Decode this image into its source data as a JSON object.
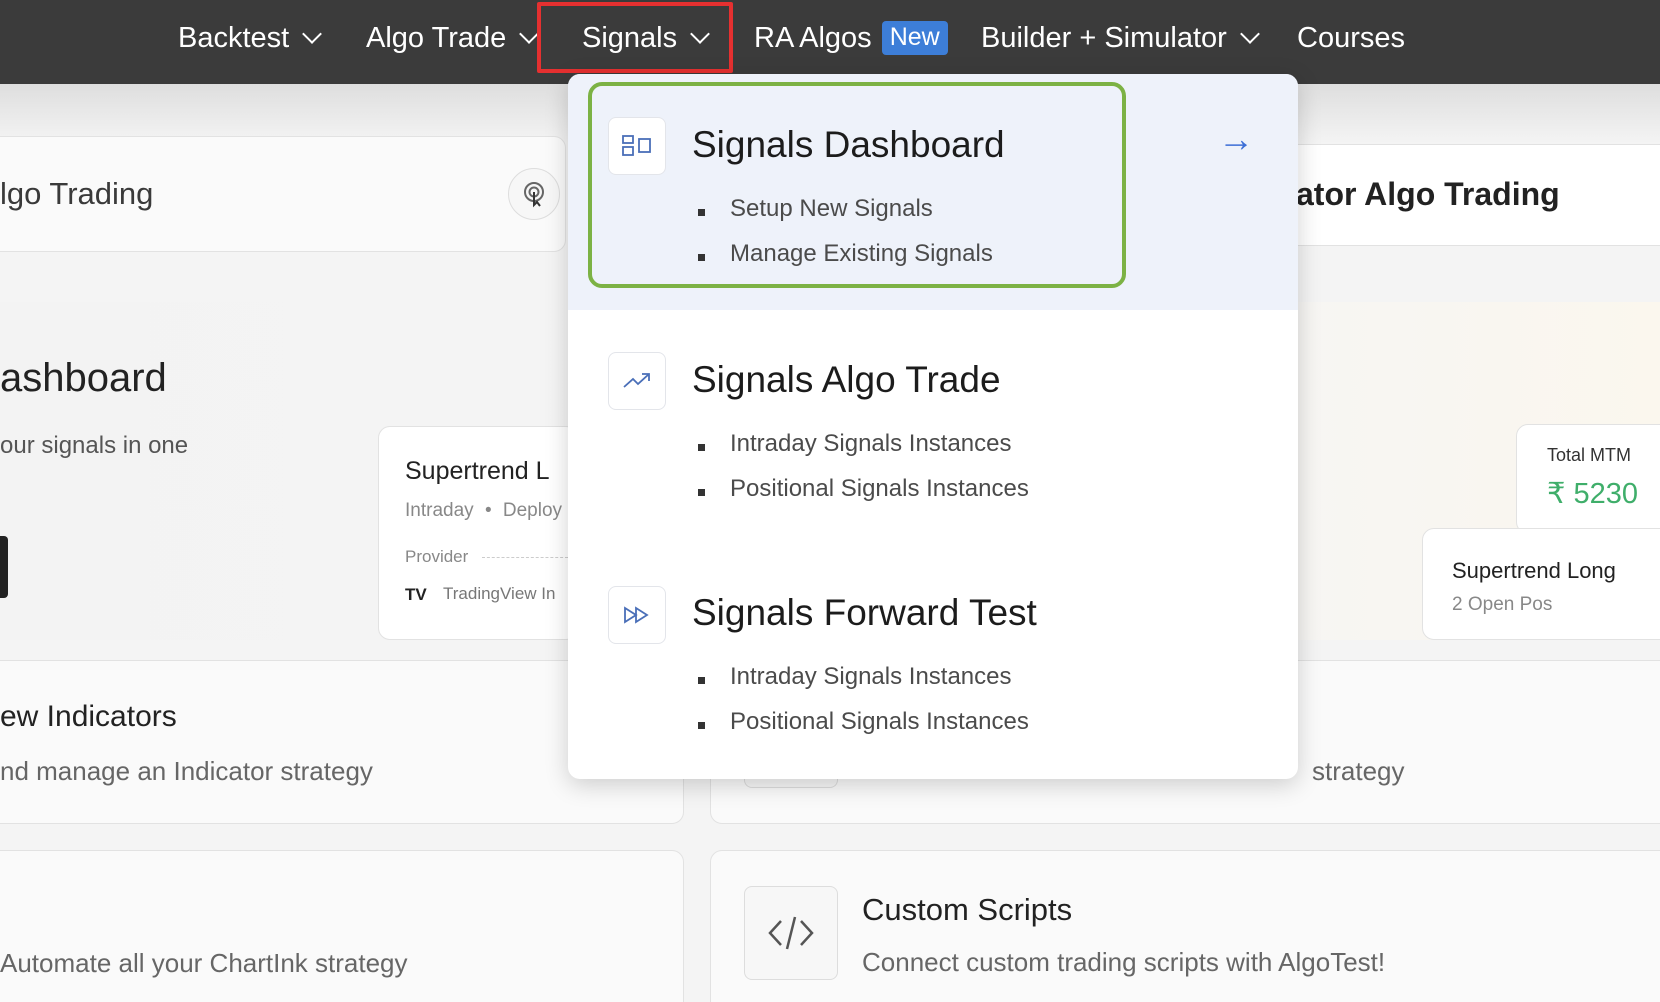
{
  "nav": {
    "items": [
      {
        "label": "Backtest"
      },
      {
        "label": "Algo Trade"
      },
      {
        "label": "Signals"
      },
      {
        "label": "RA Algos",
        "badge": "New"
      },
      {
        "label": "Builder + Simulator"
      },
      {
        "label": "Courses"
      }
    ]
  },
  "background": {
    "algo_trading_title": "lgo Trading",
    "indicator_algo_title": "ator Algo Trading",
    "dashboard_title": "ashboard",
    "dashboard_subtitle": "our signals in one",
    "strategy_card": {
      "name": "Supertrend L",
      "meta_type": "Intraday",
      "meta_status": "Deploy",
      "provider_label": "Provider",
      "provider_name": "TradingView In"
    },
    "total_mtm_label": "Total MTM",
    "total_mtm_value": "₹ 5230",
    "long_card": {
      "name": "Supertrend Long",
      "positions": "2 Open Pos"
    },
    "indicators": {
      "title": "ew Indicators",
      "desc": "nd manage an Indicator strategy"
    },
    "right_strategy_desc": "strategy",
    "chartink": {
      "desc": "Automate all your ChartInk strategy"
    },
    "custom_scripts": {
      "title": "Custom Scripts",
      "desc": "Connect custom trading scripts with AlgoTest!"
    }
  },
  "dropdown": {
    "items": [
      {
        "title": "Signals Dashboard",
        "subs": [
          "Setup New Signals",
          "Manage Existing Signals"
        ],
        "icon": "dashboard-icon"
      },
      {
        "title": "Signals Algo Trade",
        "subs": [
          "Intraday Signals Instances",
          "Positional Signals Instances"
        ],
        "icon": "trend-up-icon"
      },
      {
        "title": "Signals Forward Test",
        "subs": [
          "Intraday Signals Instances",
          "Positional Signals Instances"
        ],
        "icon": "fast-forward-icon"
      }
    ],
    "arrow": "→"
  },
  "colors": {
    "nav_bg": "#3b3b3b",
    "highlight_red": "#e53030",
    "highlight_green": "#7cb244",
    "accent_blue": "#3d7ed8",
    "mtm_green": "#3fae6a"
  }
}
